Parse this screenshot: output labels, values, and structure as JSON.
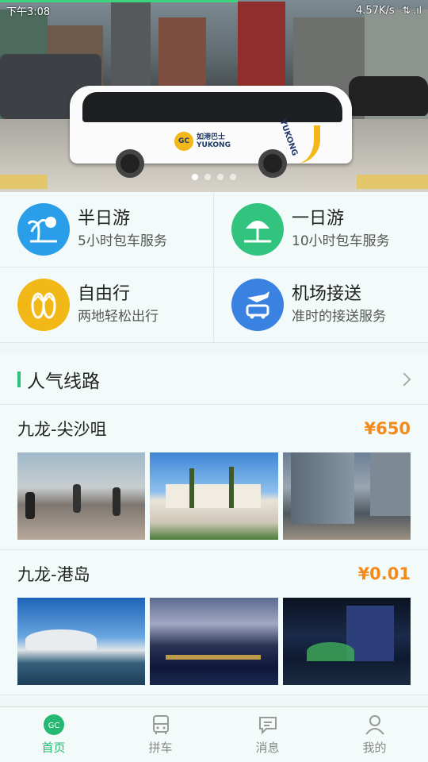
{
  "status_bar": {
    "time": "下午3:08",
    "network": "4.57K/s",
    "signal": "⇅ .ıl"
  },
  "banner": {
    "bus_brand_cn": "如港巴士",
    "bus_brand_en": "YUKONG",
    "bus_side_text": "YUKONG",
    "slides": 4,
    "active_slide": 0
  },
  "services": [
    {
      "title": "半日游",
      "subtitle": "5小时包车服务",
      "icon": "palm-tree-sun-icon",
      "color": "#2a9ee8"
    },
    {
      "title": "一日游",
      "subtitle": "10小时包车服务",
      "icon": "beach-umbrella-icon",
      "color": "#32c47e"
    },
    {
      "title": "自由行",
      "subtitle": "两地轻松出行",
      "icon": "flip-flops-icon",
      "color": "#f2b818"
    },
    {
      "title": "机场接送",
      "subtitle": "准时的接送服务",
      "icon": "plane-bus-icon",
      "color": "#3a82e2"
    }
  ],
  "popular": {
    "title": "人气线路",
    "routes": [
      {
        "name": "九龙-尖沙咀",
        "price": "¥650",
        "photos": [
          "promenade",
          "palm-building",
          "glass-towers"
        ]
      },
      {
        "name": "九龙-港岛",
        "price": "¥0.01",
        "photos": [
          "convention-centre",
          "harbour-night",
          "night-lights"
        ]
      }
    ]
  },
  "tabbar": [
    {
      "label": "首页",
      "icon": "home-logo-icon",
      "active": true
    },
    {
      "label": "拼车",
      "icon": "bus-icon",
      "active": false
    },
    {
      "label": "消息",
      "icon": "message-icon",
      "active": false
    },
    {
      "label": "我的",
      "icon": "user-icon",
      "active": false
    }
  ],
  "colors": {
    "accent": "#25b871",
    "price": "#f28a1d"
  }
}
